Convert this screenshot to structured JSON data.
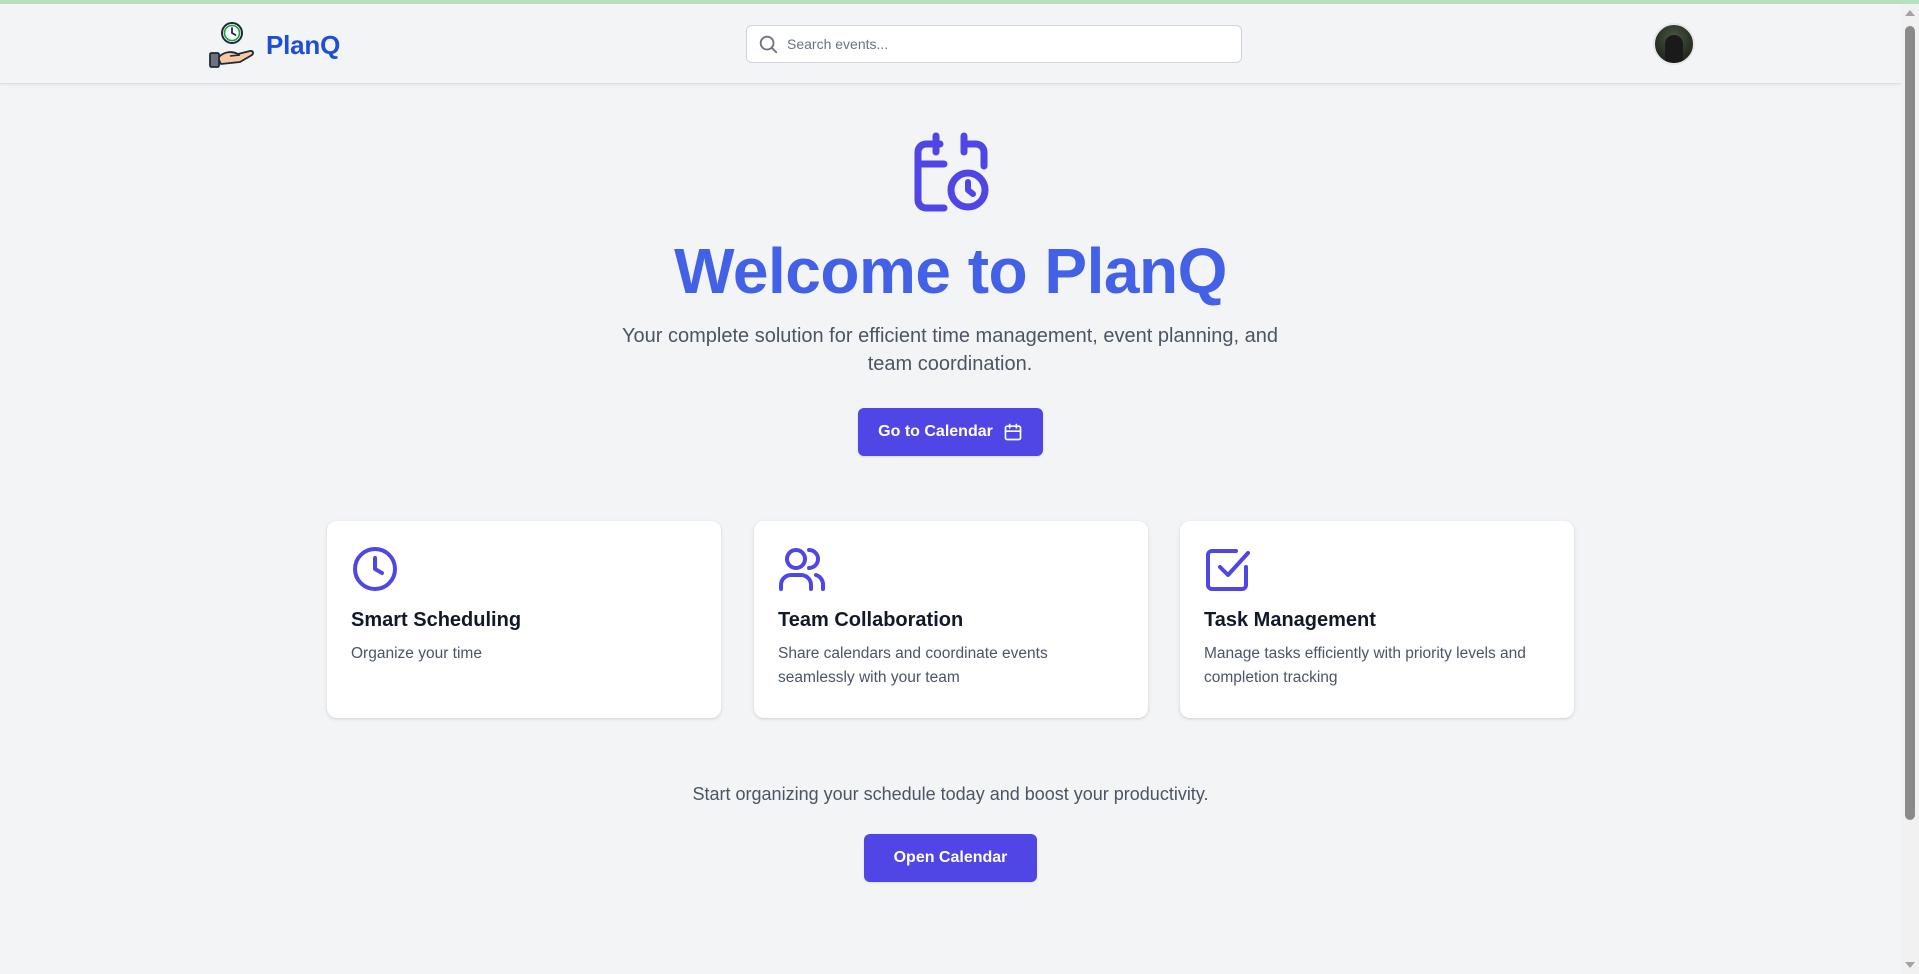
{
  "navbar": {
    "brand_name": "PlanQ",
    "search": {
      "placeholder": "Search events...",
      "value": ""
    }
  },
  "hero": {
    "title": "Welcome to PlanQ",
    "subtitle": "Your complete solution for efficient time management, event planning, and team coordination.",
    "primary_button_label": "Go to Calendar"
  },
  "features": [
    {
      "icon": "clock-icon",
      "title": "Smart Scheduling",
      "description": "Organize your time"
    },
    {
      "icon": "users-icon",
      "title": "Team Collaboration",
      "description": "Share calendars and coordinate events seamlessly with your team"
    },
    {
      "icon": "checkbox-icon",
      "title": "Task Management",
      "description": "Manage tasks efficiently with priority levels and completion tracking"
    }
  ],
  "cta": {
    "text": "Start organizing your schedule today and boost your productivity.",
    "button_label": "Open Calendar"
  },
  "colors": {
    "accent": "#4f46e5",
    "title": "#4361e6",
    "brand": "#1d4ed8",
    "background": "#f3f4f6"
  }
}
